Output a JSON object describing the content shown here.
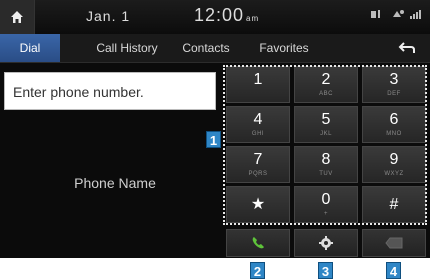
{
  "status": {
    "date": "Jan. 1",
    "time": "12:00",
    "ampm": "am"
  },
  "tabs": [
    {
      "label": "Dial",
      "active": true
    },
    {
      "label": "Call History",
      "active": false
    },
    {
      "label": "Contacts",
      "active": false
    },
    {
      "label": "Favorites",
      "active": false
    }
  ],
  "phone_input_placeholder": "Enter phone number.",
  "phone_name": "Phone Name",
  "keypad": [
    {
      "digit": "1",
      "letters": ""
    },
    {
      "digit": "2",
      "letters": "ABC"
    },
    {
      "digit": "3",
      "letters": "DEF"
    },
    {
      "digit": "4",
      "letters": "GHI"
    },
    {
      "digit": "5",
      "letters": "JKL"
    },
    {
      "digit": "6",
      "letters": "MNO"
    },
    {
      "digit": "7",
      "letters": "PQRS"
    },
    {
      "digit": "8",
      "letters": "TUV"
    },
    {
      "digit": "9",
      "letters": "WXYZ"
    },
    {
      "digit": "★",
      "letters": ""
    },
    {
      "digit": "0",
      "letters": "+"
    },
    {
      "digit": "#",
      "letters": ""
    }
  ],
  "actions": [
    {
      "name": "call-icon"
    },
    {
      "name": "gear-icon"
    },
    {
      "name": "backspace-icon"
    }
  ],
  "callouts": [
    "1",
    "2",
    "3",
    "4"
  ],
  "colors": {
    "accent_tab": "#2a4d86",
    "call_green": "#5ec23a",
    "callout_blue": "#2f86c6"
  }
}
